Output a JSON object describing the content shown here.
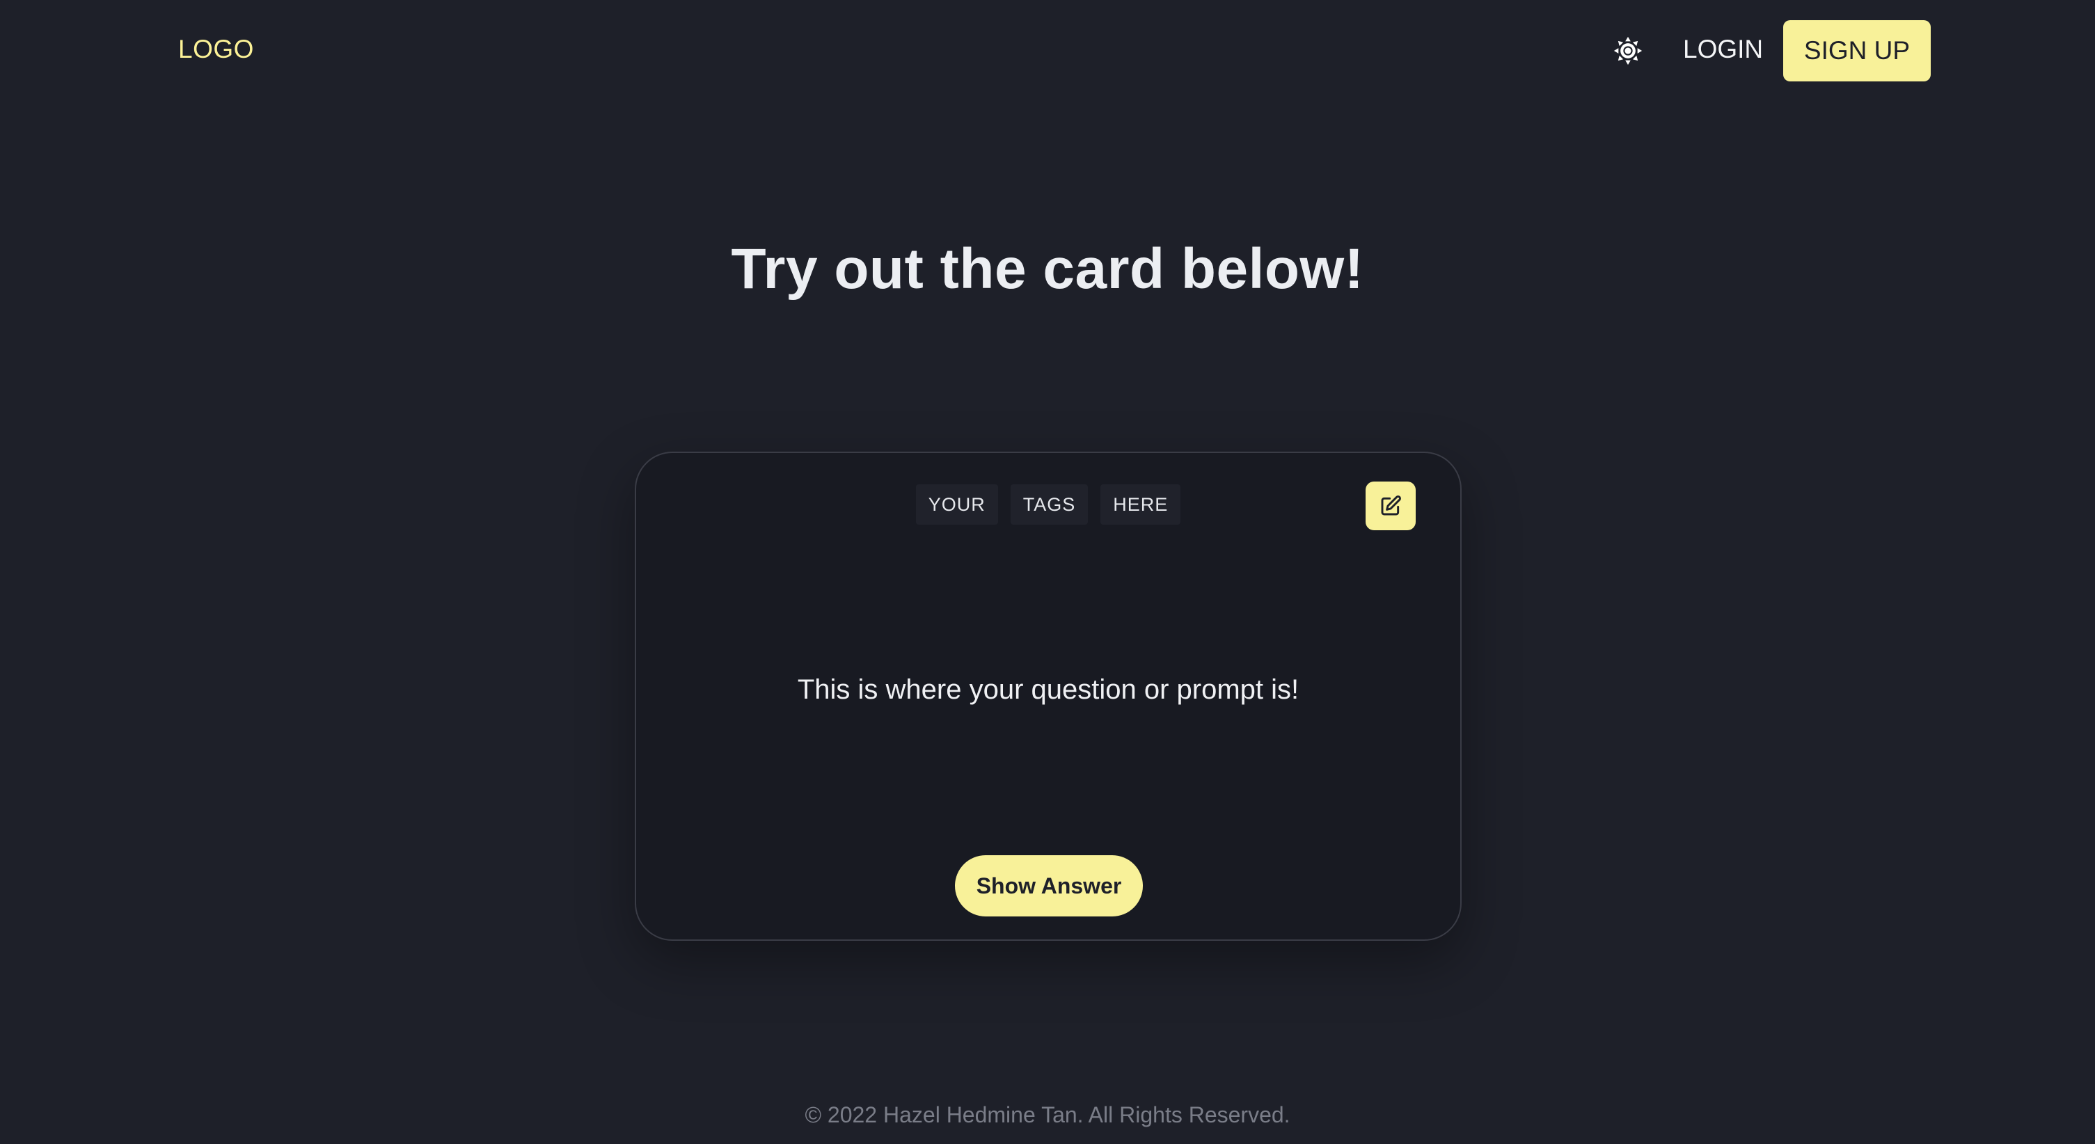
{
  "header": {
    "logo": "LOGO",
    "theme_icon": "sun-icon",
    "login_label": "LOGIN",
    "signup_label": "SIGN UP"
  },
  "main": {
    "heading": "Try out the card below!"
  },
  "card": {
    "tags": [
      "YOUR",
      "TAGS",
      "HERE"
    ],
    "edit_icon": "edit-icon",
    "prompt": "This is where your question or prompt is!",
    "show_answer_label": "Show Answer"
  },
  "footer": {
    "copyright": "© 2022 Hazel Hedmine Tan. All Rights Reserved."
  },
  "colors": {
    "background": "#1e2029",
    "accent": "#f8f199",
    "logo": "#fcf297",
    "card_background": "#181a22"
  }
}
